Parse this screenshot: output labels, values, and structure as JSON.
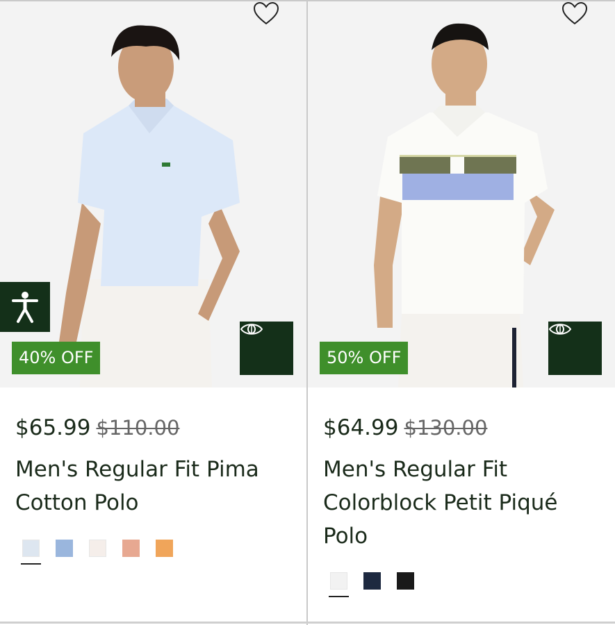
{
  "products": [
    {
      "discount_badge": "40% OFF",
      "price": "$65.99",
      "old_price": "$110.00",
      "name_line1": "Men's Regular Fit Pima",
      "name_line2": "Cotton Polo",
      "name_line3": "",
      "swatches": [
        "#dde6f0",
        "#9ab6dd",
        "#f5eeea",
        "#e7a891",
        "#f0a55a"
      ],
      "selected_swatch": 0
    },
    {
      "discount_badge": "50% OFF",
      "price": "$64.99",
      "old_price": "$130.00",
      "name_line1": "Men's Regular Fit",
      "name_line2": "Colorblock Petit Piqué",
      "name_line3": "Polo",
      "swatches": [
        "#f2f2f2",
        "#1d2940",
        "#1a1a1a"
      ],
      "selected_swatch": 0
    }
  ],
  "icons": {
    "wishlist": "heart-outline-icon",
    "quick_view": "eye-icon",
    "accessibility": "accessibility-person-icon"
  },
  "colors": {
    "badge_green": "#3f8f2b",
    "dark_green": "#143019",
    "text": "#1a2a1a"
  }
}
